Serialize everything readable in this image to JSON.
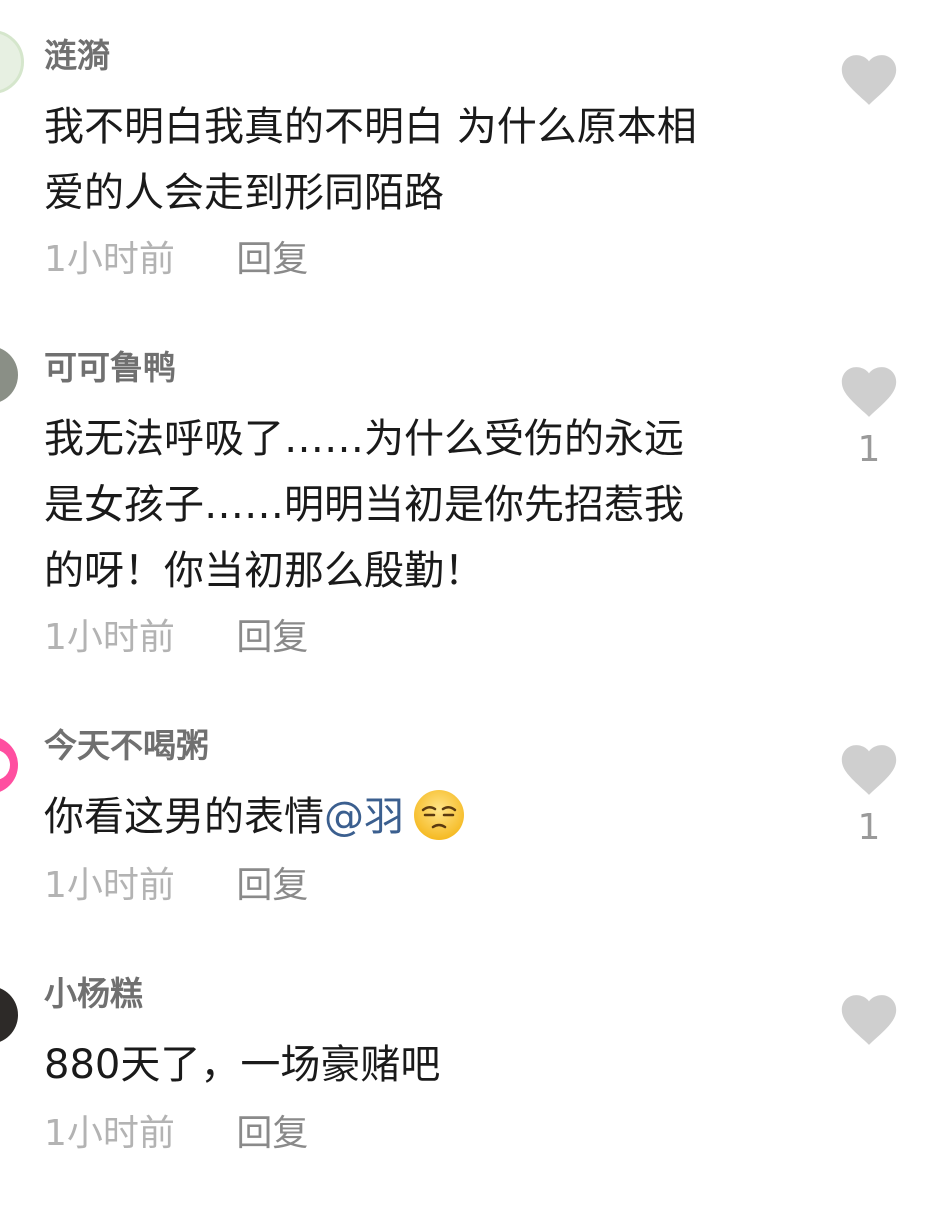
{
  "comments": [
    {
      "username": "涟漪",
      "lines": [
        "我不明白我真的不明白 为什么原本相",
        "爱的人会走到形同陌路"
      ],
      "time": "1小时前",
      "reply_label": "回复",
      "like_count": "",
      "avatar_color": "#e7f0e2"
    },
    {
      "username": "可可鲁鸭",
      "lines": [
        "我无法呼吸了……为什么受伤的永远",
        "是女孩子……明明当初是你先招惹我",
        "的呀！你当初那么殷勤！"
      ],
      "time": "1小时前",
      "reply_label": "回复",
      "like_count": "1",
      "avatar_color": "#8a8f86"
    },
    {
      "username": "今天不喝粥",
      "text_before_mention": "你看这男的表情",
      "mention": "@羽",
      "emoji": "smirk-emoji",
      "time": "1小时前",
      "reply_label": "回复",
      "like_count": "1",
      "avatar_color": "#ff4fa0"
    },
    {
      "username": "小杨糕",
      "lines": [
        "880天了，一场豪赌吧"
      ],
      "time": "1小时前",
      "reply_label": "回复",
      "like_count": "",
      "avatar_color": "#2d2a28"
    }
  ],
  "colors": {
    "username": "#707070",
    "body_text": "#1a1a1a",
    "meta": "#b3b3b3",
    "mention": "#3b5f8f",
    "heart": "#cfcfcf"
  }
}
